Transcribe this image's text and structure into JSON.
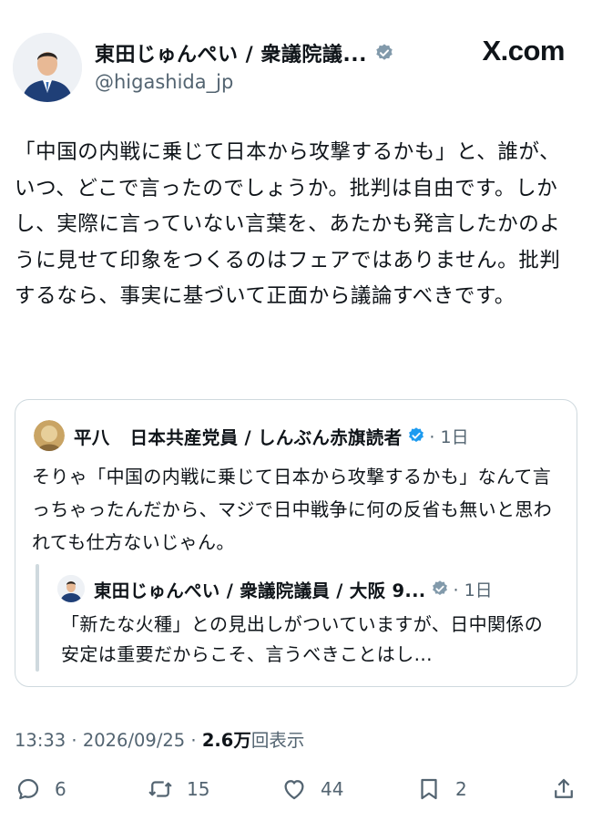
{
  "brand": {
    "logo_text": "X.com"
  },
  "author": {
    "name": "東田じゅんぺい / 衆議院議...",
    "handle": "@higashida_jp",
    "verified": true
  },
  "tweet": {
    "text": "「中国の内戦に乗じて日本から攻撃するかも」と、誰が、いつ、どこで言ったのでしょうか。批判は自由です。しかし、実際に言っていない言葉を、あたかも発言したかのように見せて印象をつくるのはフェアではありません。批判するなら、事実に基づいて正面から議論すべきです。"
  },
  "quoted": {
    "name_part1": "平八",
    "name_part2": "日本共産党員 / しんぶん赤旗読者",
    "time": "· 1日",
    "text": "そりゃ「中国の内戦に乗じて日本から攻撃するかも」なんて言っちゃったんだから、マジで日中戦争に何の反省も無いと思われても仕方ないじゃん。",
    "nested": {
      "name": "東田じゅんぺい / 衆議院議員 / 大阪 9...",
      "time": "· 1日",
      "text": "「新たな火種」との見出しがついていますが、日中関係の安定は重要だからこそ、言うべきことはし..."
    }
  },
  "meta": {
    "time": "13:33",
    "sep1": " · ",
    "date": "2026/09/25",
    "sep2": " · ",
    "views_count": "2.6万",
    "views_label": "回表示"
  },
  "actions": {
    "replies": "6",
    "retweets": "15",
    "likes": "44",
    "bookmarks": "2"
  },
  "colors": {
    "text": "#0f1419",
    "secondary": "#536471",
    "verified": "#829aab",
    "border": "#cfd9de"
  },
  "icons": [
    "verified-badge-icon",
    "reply-icon",
    "retweet-icon",
    "like-icon",
    "bookmark-icon",
    "share-icon"
  ]
}
